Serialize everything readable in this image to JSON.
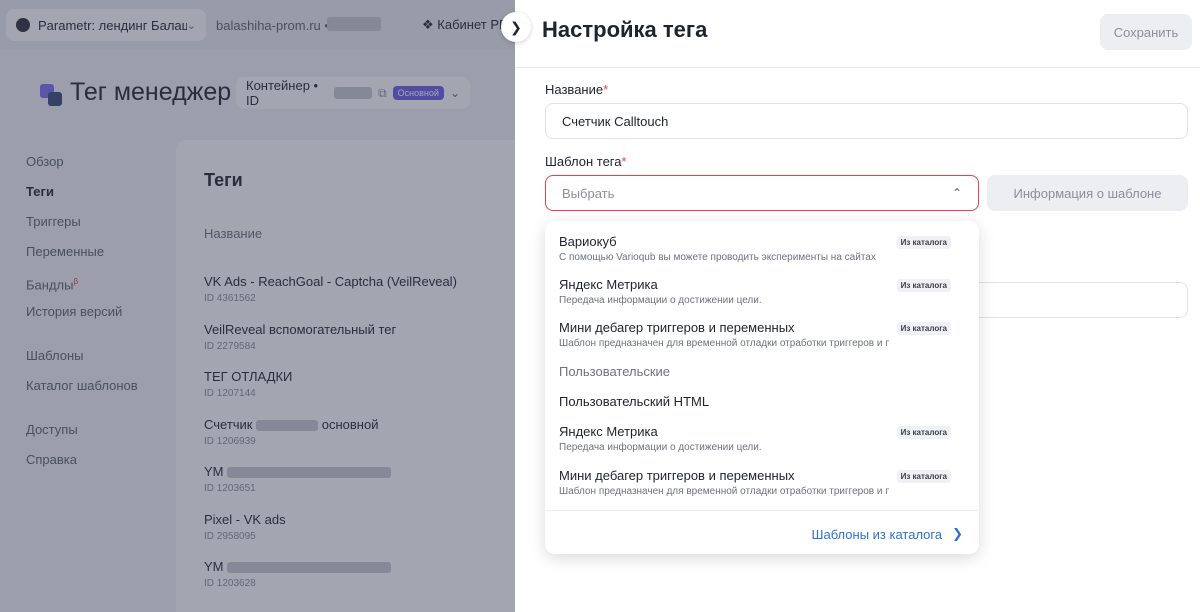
{
  "topbar": {
    "project": "Parametr: лендинг Балашиха",
    "domain": "balashiha-prom.ru  •",
    "cabinet": "Кабинет PR"
  },
  "brand": {
    "title": "Тег менеджер",
    "container_label": "Контейнер • ID",
    "badge": "Основной"
  },
  "sidebar": {
    "items": [
      {
        "label": "Обзор"
      },
      {
        "label": "Теги"
      },
      {
        "label": "Триггеры"
      },
      {
        "label": "Переменные"
      },
      {
        "label": "Бандлы",
        "sup": "β"
      },
      {
        "label": "История версий"
      },
      {
        "label": "Шаблоны"
      },
      {
        "label": "Каталог шаблонов"
      },
      {
        "label": "Доступы"
      },
      {
        "label": "Справка"
      }
    ]
  },
  "main": {
    "title": "Теги",
    "column_header": "Название",
    "tags": [
      {
        "name": "VK Ads - ReachGoal - Captcha (VeilReveal)",
        "id": "ID 4361562"
      },
      {
        "name": "VeilReveal вспомогательный тег",
        "id": "ID 2279584"
      },
      {
        "name": "ТЕГ ОТЛАДКИ",
        "id": "ID 1207144"
      },
      {
        "name": "Счетчик",
        "name_suffix": "основной",
        "id": "ID 1206939"
      },
      {
        "name": "YM",
        "id": "ID 1203651"
      },
      {
        "name": "Pixel - VK ads",
        "id": "ID 2958095"
      },
      {
        "name": "YM",
        "id": "ID 1203628"
      }
    ]
  },
  "drawer": {
    "title": "Настройка тега",
    "save_label": "Сохранить",
    "name_label": "Название",
    "name_value": "Счетчик Calltouch",
    "template_label": "Шаблон тега",
    "select_placeholder": "Выбрать",
    "info_button": "Информация о шаблоне",
    "required_mark": "*"
  },
  "dropdown": {
    "items": [
      {
        "title": "Вариокуб",
        "desc": "С помощью Varioqub вы можете проводить эксперименты на сайтах",
        "badge": "Из каталога"
      },
      {
        "title": "Яндекс Метрика",
        "desc": "Передача информации о достижении цели.",
        "badge": "Из каталога"
      },
      {
        "title": "Мини дебагер триггеров и переменных",
        "desc": "Шаблон предназначен для временной отладки отработки триггеров и переменных",
        "badge": "Из каталога"
      }
    ],
    "group_label": "Пользовательские",
    "custom_items": [
      {
        "title": "Пользовательский HTML"
      },
      {
        "title": "Яндекс Метрика",
        "desc": "Передача информации о достижении цели.",
        "badge": "Из каталога"
      },
      {
        "title": "Мини дебагер триггеров и переменных",
        "desc": "Шаблон предназначен для временной отладки отработки триггеров и переменных",
        "badge": "Из каталога"
      }
    ],
    "footer_link": "Шаблоны из каталога"
  }
}
